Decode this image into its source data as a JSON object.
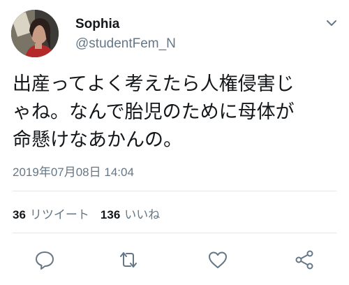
{
  "tweet": {
    "author": {
      "display_name": "Sophia",
      "handle": "@studentFem_N"
    },
    "text_lines": [
      "出産ってよく考えたら人権侵害じ",
      "ゃね。なんで胎児のために母体が",
      "命懸けなあかんの。"
    ],
    "timestamp": "2019年07月08日 14:04",
    "stats": {
      "retweets": {
        "count": "36",
        "label": "リツイート"
      },
      "likes": {
        "count": "136",
        "label": "いいね"
      }
    },
    "icons": {
      "caret": "chevron-down-icon",
      "reply": "reply-icon",
      "retweet": "retweet-icon",
      "like": "heart-icon",
      "share": "share-icon"
    },
    "colors": {
      "text": "#14171a",
      "secondary": "#657786",
      "icon": "#657786",
      "divider": "#e1e8ed"
    }
  }
}
